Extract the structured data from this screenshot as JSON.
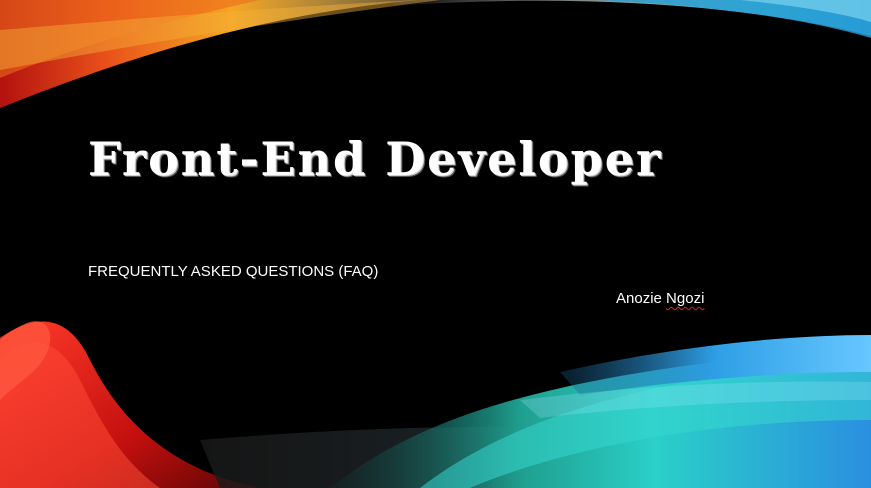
{
  "slide": {
    "title": "Front-End Developer",
    "subtitle": "FREQUENTLY ASKED QUESTIONS (FAQ)",
    "author_first": "Anozie",
    "author_last": "Ngozi"
  },
  "colors": {
    "background": "#000000",
    "text": "#ffffff",
    "spell_check_underline": "#e02020",
    "swoosh_orange": "#f28a1e",
    "swoosh_red": "#d01818",
    "swoosh_teal": "#22c3c3",
    "swoosh_blue": "#2a8fe0"
  }
}
